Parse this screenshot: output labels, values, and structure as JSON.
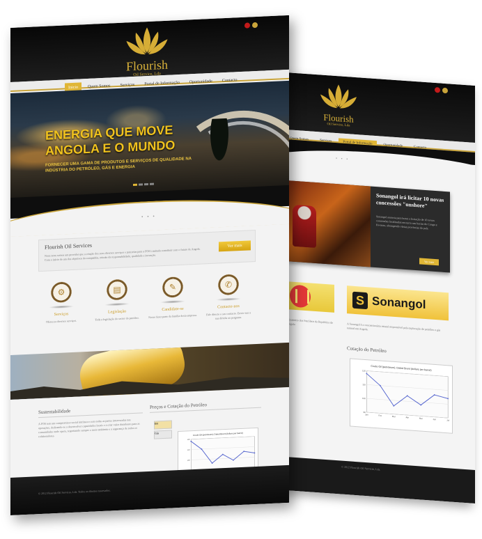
{
  "colors": {
    "gold": "#e0b636",
    "dark": "#0e0e0e",
    "line": "#5a6ad0"
  },
  "front": {
    "brand": {
      "name": "Flourish",
      "tagline": "Oil Service, Lda"
    },
    "nav": [
      "Inicio",
      "Quem Somos",
      "Serviços",
      "Portal de Informação",
      "Oportunidade",
      "Contacto"
    ],
    "hero": {
      "title": "ENERGIA QUE MOVE ANGOLA E O MUNDO",
      "subtitle": "FORNECER UMA GAMA DE PRODUTOS E SERVIÇOS DE QUALIDADE NA INDÚSTRIA DO PETRÓLEO, GÁS E ENERGIA"
    },
    "intro": {
      "title": "Flourish Oil Services",
      "text": "Nous nous somos um providor que a criação dos seus diversos serviços e parcerias para a FOS Limitada contribuir com o futuro de Angola. Com o início de um dos objetivos da companhia, missão da responsabilidade, qualidade e inovação.",
      "button": "Ver mais"
    },
    "services": [
      {
        "icon": "gears-icon",
        "title": "Serviços",
        "text": "Ofereceu diversos serviços."
      },
      {
        "icon": "document-icon",
        "title": "Legislação",
        "text": "Toda a legislação do sector do petróleo."
      },
      {
        "icon": "clipboard-icon",
        "title": "Candidate-se",
        "text": "Nosso fazer parte da família desta empresa."
      },
      {
        "icon": "contact-icon",
        "title": "Contacte-nos",
        "text": "Fale directo o seu contacto. Envie-nos a sua dúvida ou pergunta."
      }
    ],
    "sustain": {
      "title": "Sustentabilidade",
      "text": "A FOS tem um compromisso social intrínseco com todas as partes interessadas nas operações, dedicando-se a desenvolver capacidades locais e a criar valor duradouro para as comunidades onde opera, respeitando sempre o meio ambiente e a segurança de todos os colaboradores."
    },
    "price": {
      "title": "Preços e Cotação do Petróleo",
      "tabs": [
        "Brt",
        "Gás"
      ]
    },
    "footer": "© 2012 Flourish Oil Services, Lda. Todos os direitos reservados."
  },
  "back": {
    "nav": [
      "Quem Somos",
      "Serviços",
      "Portal de Informação",
      "Oportunidade",
      "Contacto"
    ],
    "news": {
      "title": "Sonangol irá licitar 10 novas concessões \"onshore\"",
      "text": "Sonangol anuncia para breve a licitação de 10 novas concessões localizadas em terra nas bacias do Congo e Kwanza, abrangendo várias províncias do país.",
      "button": "Ver mais"
    },
    "partner_logo": "Sonangol",
    "left_caption": "Ministério dos Petróleos da República de Angola",
    "right_caption": "A Sonangol é a concessionária estatal responsável pela exploração de petróleo e gás natural em Angola.",
    "chart_title": "Cotação do Petróleo",
    "footer": "© 2012 Flourish Oil Services, Lda."
  },
  "chart_data": [
    {
      "type": "line",
      "title": "Crude Oil (petroleum); Dated Brent (dollars per barrel)",
      "x": [
        "Jan",
        "Fev",
        "Mar",
        "Abr",
        "Mai",
        "Jun",
        "Jul"
      ],
      "series": [
        {
          "values": [
            118,
            110,
            96,
            104,
            98,
            106,
            104
          ]
        }
      ],
      "ylim": [
        90,
        120
      ]
    },
    {
      "type": "line",
      "title": "Crude Oil (petroleum); Dated Brent (dollars per barrel)",
      "x": [
        "Jan",
        "Fev",
        "Mar",
        "Abr",
        "Mai",
        "Jun",
        "Jul"
      ],
      "series": [
        {
          "values": [
            118,
            110,
            96,
            104,
            98,
            106,
            104
          ]
        }
      ],
      "ylim": [
        90,
        120
      ]
    }
  ]
}
